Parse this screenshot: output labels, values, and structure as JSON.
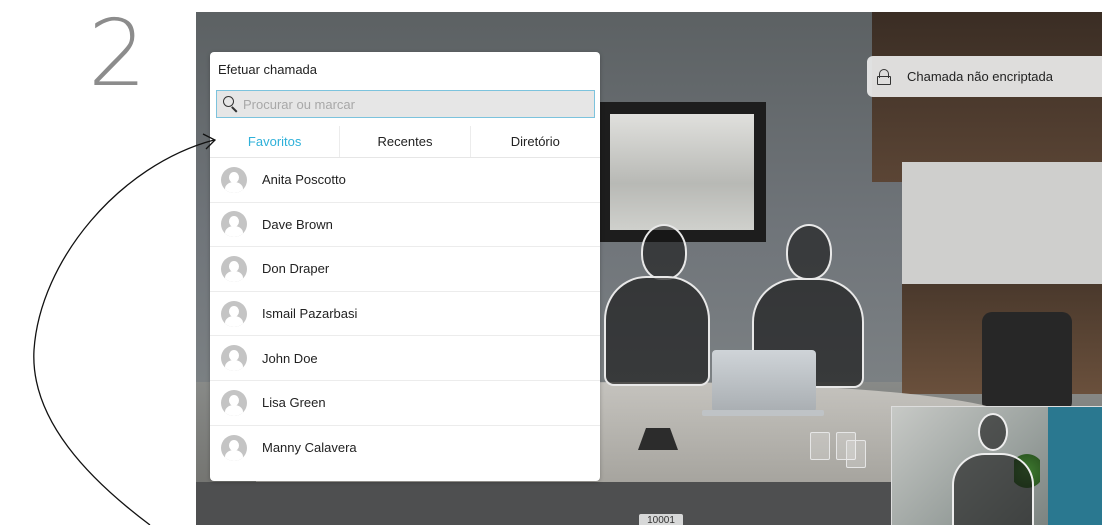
{
  "step": "2",
  "encryption_status": {
    "label": "Chamada não encriptada",
    "icon": "lock-open-icon"
  },
  "call_panel": {
    "title": "Efetuar chamada",
    "search": {
      "placeholder": "Procurar ou marcar",
      "value": ""
    },
    "tabs": [
      {
        "label": "Favoritos",
        "active": true
      },
      {
        "label": "Recentes",
        "active": false
      },
      {
        "label": "Diretório",
        "active": false
      }
    ],
    "contacts": [
      "Anita Poscotto",
      "Dave Brown",
      "Don Draper",
      "Ismail Pazarbasi",
      "John Doe",
      "Lisa Green",
      "Manny Calavera"
    ]
  },
  "meeting_number": "10001",
  "colors": {
    "accent": "#2fb1d9",
    "search_border": "#7cc3dd"
  }
}
